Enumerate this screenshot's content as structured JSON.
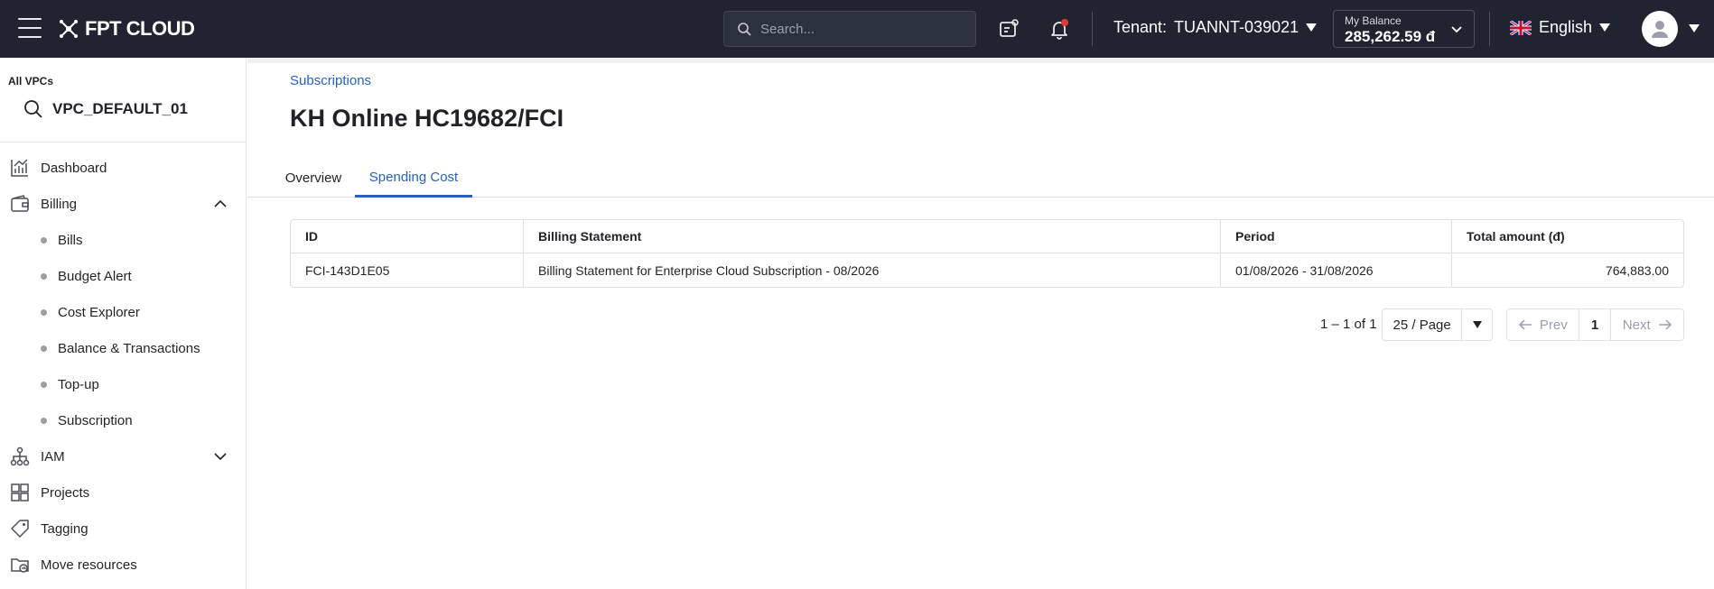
{
  "topbar": {
    "brand": "FPT CLOUD",
    "search_placeholder": "Search...",
    "tenant_label": "Tenant:",
    "tenant_value": "TUANNT-039021",
    "balance_label": "My Balance",
    "balance_value": "285,262.59 đ",
    "language": "English"
  },
  "sidebar": {
    "vpc_label": "All VPCs",
    "vpc_name": "VPC_DEFAULT_01",
    "items": [
      {
        "label": "Dashboard",
        "icon": "chart-icon"
      },
      {
        "label": "Billing",
        "icon": "wallet-icon",
        "expanded": true
      },
      {
        "label": "IAM",
        "icon": "org-icon",
        "expanded": false
      },
      {
        "label": "Projects",
        "icon": "projects-icon"
      },
      {
        "label": "Tagging",
        "icon": "tag-icon"
      },
      {
        "label": "Move resources",
        "icon": "folder-move-icon"
      }
    ],
    "billing_sub": [
      "Bills",
      "Budget Alert",
      "Cost Explorer",
      "Balance & Transactions",
      "Top-up",
      "Subscription"
    ]
  },
  "main": {
    "breadcrumb": "Subscriptions",
    "title": "KH Online HC19682/FCI",
    "tabs": [
      {
        "label": "Overview",
        "active": false
      },
      {
        "label": "Spending Cost",
        "active": true
      }
    ],
    "table": {
      "columns": [
        "ID",
        "Billing Statement",
        "Period",
        "Total amount (đ)"
      ],
      "rows": [
        [
          "FCI-143D1E05",
          "Billing Statement for Enterprise Cloud Subscription - 08/2026",
          "01/08/2026 - 31/08/2026",
          "764,883.00"
        ]
      ]
    },
    "pagination": {
      "range": "1 – 1 of 1",
      "page_size": "25 / Page",
      "prev": "Prev",
      "current": "1",
      "next": "Next"
    }
  },
  "colors": {
    "topbar_bg": "#1f2430",
    "accent": "#2760c4",
    "notification_dot": "#e53935"
  }
}
